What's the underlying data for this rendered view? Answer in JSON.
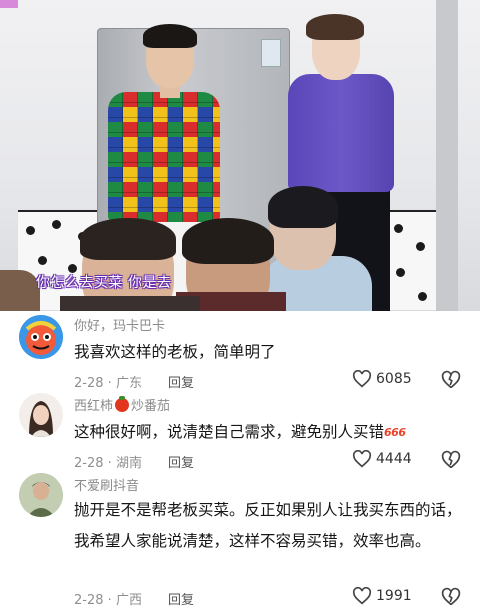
{
  "video": {
    "subtitle": "你怎么去买菜 你是去"
  },
  "comments": [
    {
      "username": "你好，玛卡巴卡",
      "text": "我喜欢这样的老板，简单明了",
      "date": "2-28",
      "location": "广东",
      "reply_label": "回复",
      "likes": "6085",
      "avatar_icon": "cartoon-face-avatar"
    },
    {
      "username_pre": "西红柿",
      "username_post": "炒番茄",
      "text": "这种很好啊，说清楚自己需求，避免别人买错",
      "badge": "666",
      "date": "2-28",
      "location": "湖南",
      "reply_label": "回复",
      "likes": "4444",
      "avatar_icon": "woman-photo-avatar"
    },
    {
      "username": "不爱刷抖音",
      "text": "抛开是不是帮老板买菜。反正如果别人让我买东西的话，我希望人家能说清楚，这样不容易买错，效率也高。",
      "date": "2-28",
      "location": "广西",
      "reply_label": "回复",
      "likes": "1991",
      "avatar_icon": "person-photo-avatar"
    }
  ],
  "colors": {
    "subtitle_outline": "#6a2fb0",
    "meta_gray": "#8f8f8f",
    "text": "#151515"
  }
}
